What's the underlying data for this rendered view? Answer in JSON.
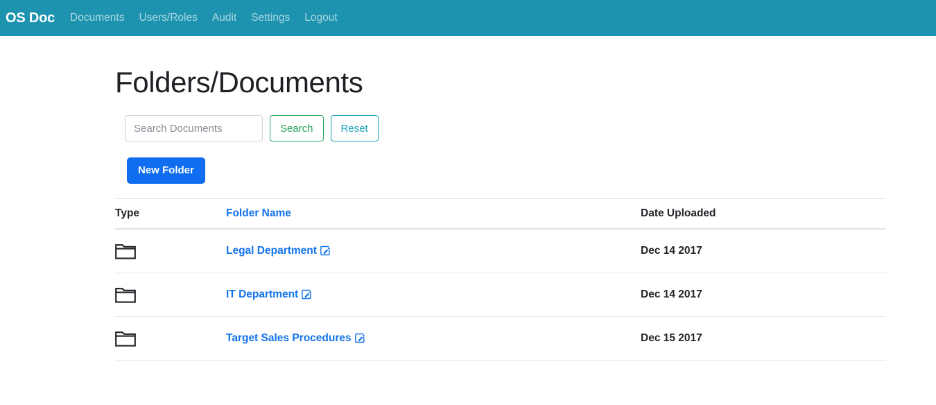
{
  "navbar": {
    "brand": "OS Doc",
    "background_color": "#1d93b0",
    "links": [
      {
        "label": "Documents",
        "name": "nav-link-documents"
      },
      {
        "label": "Users/Roles",
        "name": "nav-link-users-roles"
      },
      {
        "label": "Audit",
        "name": "nav-link-audit"
      },
      {
        "label": "Settings",
        "name": "nav-link-settings"
      },
      {
        "label": "Logout",
        "name": "nav-link-logout"
      }
    ]
  },
  "page": {
    "title": "Folders/Documents"
  },
  "search": {
    "placeholder": "Search Documents",
    "value": "",
    "search_label": "Search",
    "reset_label": "Reset",
    "search_color": "#2aa35c",
    "reset_color": "#17a2b8"
  },
  "actions": {
    "new_folder_label": "New Folder",
    "new_folder_color": "#0f6ef0"
  },
  "table": {
    "columns": {
      "type": "Type",
      "folder_name": "Folder Name",
      "date_uploaded": "Date Uploaded"
    },
    "sorted_column": "Folder Name",
    "link_color": "#1273eb",
    "rows": [
      {
        "type_icon": "folder-icon",
        "name": "Legal Department",
        "edit_icon": "edit-pencil-icon",
        "date": "Dec 14 2017"
      },
      {
        "type_icon": "folder-icon",
        "name": "IT Department",
        "edit_icon": "edit-pencil-icon",
        "date": "Dec 14 2017"
      },
      {
        "type_icon": "folder-icon",
        "name": "Target Sales Procedures",
        "edit_icon": "edit-pencil-icon",
        "date": "Dec 15 2017"
      }
    ]
  }
}
